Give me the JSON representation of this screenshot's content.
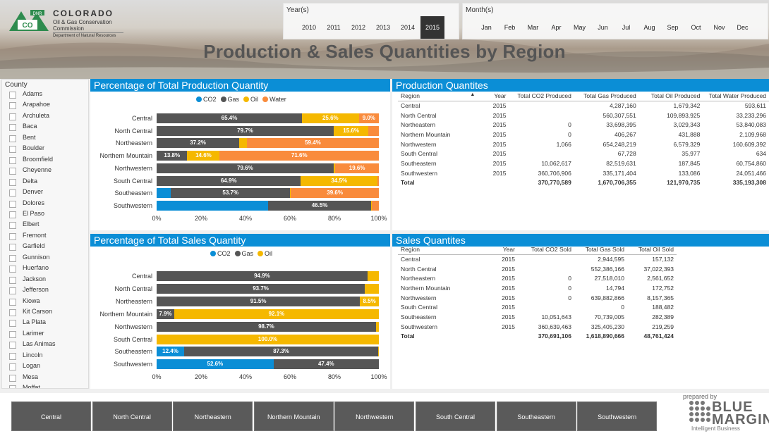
{
  "header": {
    "logo_org": "COLORADO",
    "logo_dnr": "DNR",
    "logo_initials": "CO",
    "logo_commission": "Oil & Gas Conservation Commission",
    "logo_department": "Department of Natural Resources",
    "title": "Production & Sales Quantities by Region"
  },
  "year_slicer": {
    "label": "Year(s)",
    "options": [
      "2010",
      "2011",
      "2012",
      "2013",
      "2014",
      "2015"
    ],
    "selected": "2015"
  },
  "month_slicer": {
    "label": "Month(s)",
    "options": [
      "Jan",
      "Feb",
      "Mar",
      "Apr",
      "May",
      "Jun",
      "Jul",
      "Aug",
      "Sep",
      "Oct",
      "Nov",
      "Dec"
    ]
  },
  "county_slicer": {
    "label": "County",
    "items": [
      "Adams",
      "Arapahoe",
      "Archuleta",
      "Baca",
      "Bent",
      "Boulder",
      "Broomfield",
      "Cheyenne",
      "Delta",
      "Denver",
      "Dolores",
      "El Paso",
      "Elbert",
      "Fremont",
      "Garfield",
      "Gunnison",
      "Huerfano",
      "Jackson",
      "Jefferson",
      "Kiowa",
      "Kit Carson",
      "La Plata",
      "Larimer",
      "Las Animas",
      "Lincoln",
      "Logan",
      "Mesa",
      "Moffat"
    ]
  },
  "colors": {
    "CO2": "#0b8ed6",
    "Gas": "#555555",
    "Oil": "#f5b800",
    "Water": "#f98b3c",
    "accent": "#0b8ed6"
  },
  "production_chart": {
    "title": "Percentage of Total Production Quantity",
    "legend": [
      "CO2",
      "Gas",
      "Oil",
      "Water"
    ]
  },
  "sales_chart": {
    "title": "Percentage of Total Sales Quantity",
    "legend": [
      "CO2",
      "Gas",
      "Oil"
    ]
  },
  "chart_data": [
    {
      "type": "bar",
      "stacked": true,
      "orientation": "horizontal",
      "title": "Percentage of Total Production Quantity",
      "categories": [
        "Central",
        "North Central",
        "Northeastern",
        "Northern Mountain",
        "Northwestern",
        "South Central",
        "Southeastern",
        "Southwestern"
      ],
      "series": [
        {
          "name": "CO2",
          "values": [
            0,
            0,
            0,
            0,
            0,
            0,
            6.4,
            50.1
          ],
          "labels": [
            "",
            "",
            "",
            "",
            "",
            "",
            "",
            ""
          ]
        },
        {
          "name": "Gas",
          "values": [
            65.4,
            79.7,
            37.2,
            13.8,
            79.6,
            64.9,
            53.7,
            46.5
          ],
          "labels": [
            "65.4%",
            "79.7%",
            "37.2%",
            "13.8%",
            "79.6%",
            "64.9%",
            "53.7%",
            "46.5%"
          ]
        },
        {
          "name": "Oil",
          "values": [
            25.6,
            15.6,
            3.4,
            14.6,
            0.8,
            34.5,
            0.3,
            0.1
          ],
          "labels": [
            "25.6%",
            "15.6%",
            "",
            "14.6%",
            "",
            "34.5%",
            "",
            ""
          ]
        },
        {
          "name": "Water",
          "values": [
            9.0,
            4.7,
            59.4,
            71.6,
            19.6,
            0.6,
            39.6,
            3.3
          ],
          "labels": [
            "9.0%",
            "",
            "59.4%",
            "71.6%",
            "19.6%",
            "",
            "39.6%",
            ""
          ]
        }
      ],
      "ylabel_first_row_note": "",
      "xticks": [
        "0%",
        "20%",
        "40%",
        "60%",
        "80%",
        "100%"
      ],
      "xlim": [
        0,
        100
      ]
    },
    {
      "type": "bar",
      "stacked": true,
      "orientation": "horizontal",
      "title": "Percentage of Total Sales Quantity",
      "categories": [
        "Central",
        "North Central",
        "Northeastern",
        "Northern Mountain",
        "Northwestern",
        "South Central",
        "Southeastern",
        "Southwestern"
      ],
      "series": [
        {
          "name": "CO2",
          "values": [
            0,
            0,
            0,
            0,
            0,
            0,
            12.4,
            52.6
          ],
          "labels": [
            "",
            "",
            "",
            "",
            "",
            "",
            "12.4%",
            "52.6%"
          ]
        },
        {
          "name": "Gas",
          "values": [
            94.9,
            93.7,
            91.5,
            7.9,
            98.7,
            0,
            87.3,
            47.4
          ],
          "labels": [
            "94.9%",
            "93.7%",
            "91.5%",
            "7.9%",
            "98.7%",
            "",
            "87.3%",
            "47.4%"
          ]
        },
        {
          "name": "Oil",
          "values": [
            5.1,
            6.3,
            8.5,
            92.1,
            1.3,
            100.0,
            0.3,
            0
          ],
          "labels": [
            "",
            "",
            "8.5%",
            "92.1%",
            "",
            "100.0%",
            "",
            ""
          ]
        }
      ],
      "xticks": [
        "0%",
        "20%",
        "40%",
        "60%",
        "80%",
        "100%"
      ],
      "xlim": [
        0,
        100
      ]
    }
  ],
  "production_table": {
    "title": "Production Quantites",
    "columns": [
      "Region",
      "Year",
      "Total CO2 Produced",
      "Total Gas Produced",
      "Total Oil Produced",
      "Total Water Produced"
    ],
    "sort_indicator": "▲",
    "rows": [
      [
        "Central",
        "2015",
        "",
        "4,287,160",
        "1,679,342",
        "593,611"
      ],
      [
        "North Central",
        "2015",
        "",
        "560,307,551",
        "109,893,925",
        "33,233,296"
      ],
      [
        "Northeastern",
        "2015",
        "0",
        "33,698,395",
        "3,029,343",
        "53,840,083"
      ],
      [
        "Northern Mountain",
        "2015",
        "0",
        "406,267",
        "431,888",
        "2,109,968"
      ],
      [
        "Northwestern",
        "2015",
        "1,066",
        "654,248,219",
        "6,579,329",
        "160,609,392"
      ],
      [
        "South Central",
        "2015",
        "",
        "67,728",
        "35,977",
        "634"
      ],
      [
        "Southeastern",
        "2015",
        "10,062,617",
        "82,519,631",
        "187,845",
        "60,754,860"
      ],
      [
        "Southwestern",
        "2015",
        "360,706,906",
        "335,171,404",
        "133,086",
        "24,051,466"
      ]
    ],
    "total": [
      "Total",
      "",
      "370,770,589",
      "1,670,706,355",
      "121,970,735",
      "335,193,308"
    ]
  },
  "sales_table": {
    "title": "Sales Quantites",
    "columns": [
      "Region",
      "Year",
      "Total CO2 Sold",
      "Total Gas Sold",
      "Total Oil Sold"
    ],
    "rows": [
      [
        "Central",
        "2015",
        "",
        "2,944,595",
        "157,132"
      ],
      [
        "North Central",
        "2015",
        "",
        "552,386,166",
        "37,022,393"
      ],
      [
        "Northeastern",
        "2015",
        "0",
        "27,518,010",
        "2,561,652"
      ],
      [
        "Northern Mountain",
        "2015",
        "0",
        "14,794",
        "172,752"
      ],
      [
        "Northwestern",
        "2015",
        "0",
        "639,882,866",
        "8,157,365"
      ],
      [
        "South Central",
        "2015",
        "",
        "0",
        "188,482"
      ],
      [
        "Southeastern",
        "2015",
        "10,051,643",
        "70,739,005",
        "282,389"
      ],
      [
        "Southwestern",
        "2015",
        "360,639,463",
        "325,405,230",
        "219,259"
      ]
    ],
    "total": [
      "Total",
      "",
      "370,691,106",
      "1,618,890,666",
      "48,761,424"
    ]
  },
  "region_buttons": [
    "Central",
    "North Central",
    "Northeastern",
    "Northern Mountain",
    "Northwestern",
    "South Central",
    "Southeastern",
    "Southwestern"
  ],
  "brand": {
    "prepared_by": "prepared by",
    "line1": "BLUE",
    "line2": "MARGIN",
    "tagline": "Intelligent Business"
  }
}
